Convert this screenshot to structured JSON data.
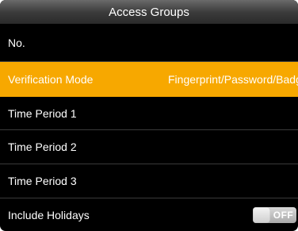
{
  "header": {
    "title": "Access Groups"
  },
  "rows": [
    {
      "label": "No.",
      "value": ""
    },
    {
      "label": "Verification Mode",
      "value": "Fingerprint/Password/Badge",
      "selected": true
    },
    {
      "label": "Time Period 1",
      "value": ""
    },
    {
      "label": "Time Period 2",
      "value": ""
    },
    {
      "label": "Time Period 3",
      "value": ""
    },
    {
      "label": "Include Holidays",
      "value": ""
    }
  ],
  "include_holidays_toggle": {
    "state_label": "OFF",
    "checked": false
  },
  "colors": {
    "selected_row": "#f7a800",
    "background": "#000000",
    "text": "#ffffff"
  }
}
